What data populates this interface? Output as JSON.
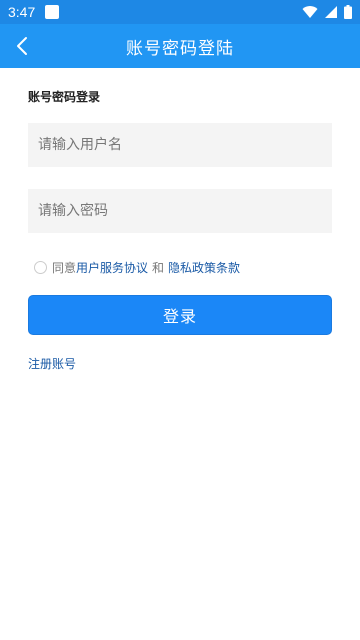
{
  "status": {
    "time": "3:47"
  },
  "header": {
    "title": "账号密码登陆",
    "back_icon": "back-arrow-icon"
  },
  "form": {
    "section_title": "账号密码登录",
    "username_placeholder": "请输入用户名",
    "password_placeholder": "请输入密码",
    "agree_prefix": "同意",
    "agreement_link": "用户服务协议",
    "agree_and": "和",
    "privacy_link": "隐私政策条款",
    "login_label": "登录",
    "register_link": "注册账号"
  },
  "colors": {
    "primary": "#2196f3",
    "status_bar": "#1e88e5",
    "button": "#1b87f7",
    "link": "#1a5aa6"
  }
}
